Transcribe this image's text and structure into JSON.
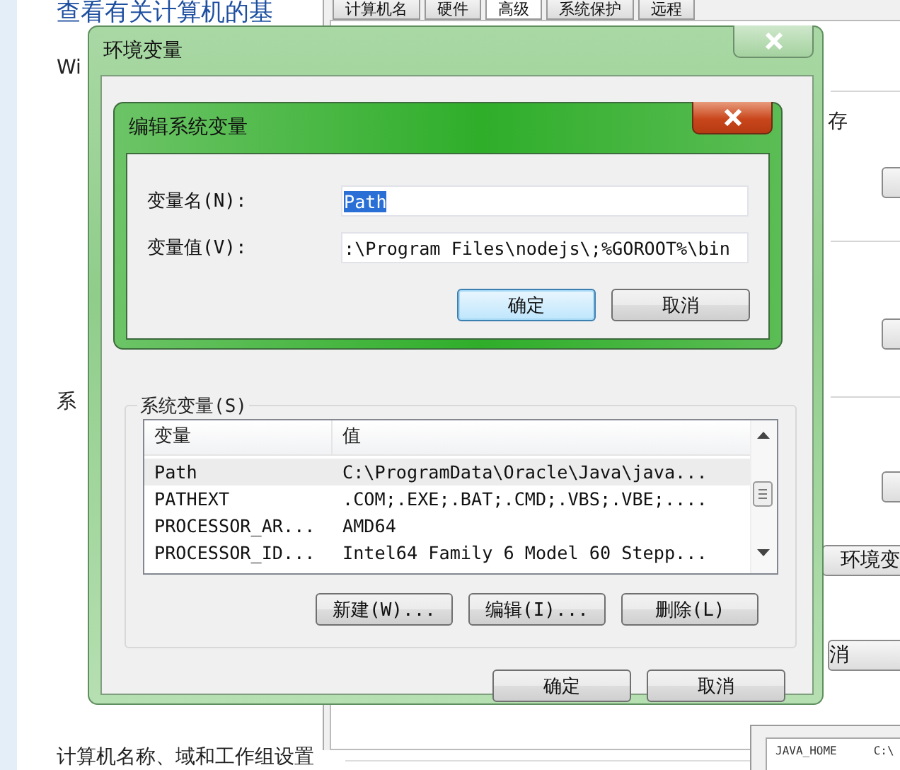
{
  "background_page": {
    "heading": "查看有关计算机的基",
    "section_1": "Wi",
    "section_2": "系",
    "section_3": "计算机名称、域和工作组设置"
  },
  "system_properties": {
    "tabs": [
      {
        "label": "计算机名",
        "selected": false
      },
      {
        "label": "硬件",
        "selected": false
      },
      {
        "label": "高级",
        "selected": true
      },
      {
        "label": "系统保护",
        "selected": false
      },
      {
        "label": "远程",
        "selected": false
      }
    ],
    "text_1": "存",
    "env_button": "环境变",
    "cancel_button": "消"
  },
  "background_list": {
    "rows": [
      {
        "name": "JAVA_HOME",
        "value": "C:\\"
      }
    ]
  },
  "env_window": {
    "title": "环境变量",
    "system_group": {
      "label": "系统变量(S)",
      "columns": [
        "变量",
        "值"
      ],
      "rows": [
        {
          "name": "Path",
          "value": "C:\\ProgramData\\Oracle\\Java\\java...",
          "selected": true
        },
        {
          "name": "PATHEXT",
          "value": ".COM;.EXE;.BAT;.CMD;.VBS;.VBE;....",
          "selected": false
        },
        {
          "name": "PROCESSOR_AR...",
          "value": "AMD64",
          "selected": false
        },
        {
          "name": "PROCESSOR_ID...",
          "value": "Intel64 Family 6 Model 60 Stepp...",
          "selected": false
        }
      ],
      "buttons": [
        "新建(W)...",
        "编辑(I)...",
        "删除(L)"
      ]
    },
    "buttons": [
      "确定",
      "取消"
    ]
  },
  "edit_dialog": {
    "title": "编辑系统变量",
    "fields": [
      {
        "label": "变量名(N):",
        "value": "Path",
        "highlighted": true
      },
      {
        "label": "变量值(V):",
        "value": ":\\Program Files\\nodejs\\;%GOROOT%\\bin",
        "highlighted": false
      }
    ],
    "buttons": [
      {
        "label": "确定",
        "focused": true
      },
      {
        "label": "取消",
        "focused": false
      }
    ]
  }
}
